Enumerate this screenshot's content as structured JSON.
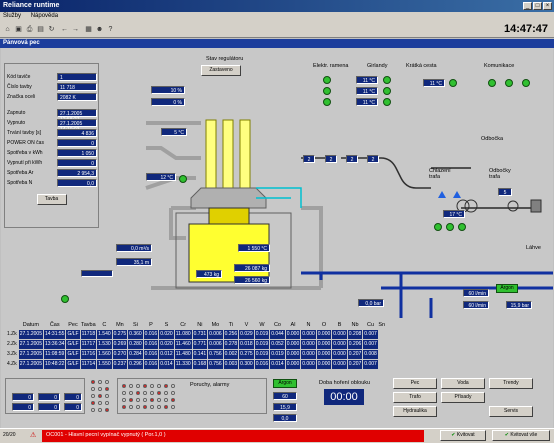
{
  "window": {
    "title": "Reliance runtime"
  },
  "menu": [
    "Služby",
    "Nápověda"
  ],
  "clock": "14:47:47",
  "panel_title": "Pánvová pec",
  "info": {
    "rows": [
      {
        "label": "Kód taviče",
        "value": "1"
      },
      {
        "label": "Číslo tavby",
        "value": "11 718"
      },
      {
        "label": "Značka oceli",
        "value": "2082 K"
      },
      {
        "label": "Zapnuto",
        "value": "27.1.2005 12:58:27"
      },
      {
        "label": "Vypnuto",
        "value": "27.1.2005 14:19:03"
      },
      {
        "label": "Trvání tavby [s]",
        "value": "4 836"
      },
      {
        "label": "POWER ON čas",
        "value": "0"
      },
      {
        "label": "Spotřeba v kWh",
        "value": "1 050"
      },
      {
        "label": "Vypnutí při kWh",
        "value": "0"
      },
      {
        "label": "Spotřeba Ar",
        "value": "2 954,3"
      },
      {
        "label": "Spotřeba N",
        "value": "0,0"
      }
    ],
    "button": "Tavba"
  },
  "regulator": {
    "label": "Stav regulátoru",
    "state": "Zastaveno"
  },
  "values": {
    "pct1": "10 %",
    "pct2": "0 %",
    "temp_top": "5 °C",
    "temp_left": "12 °C",
    "flow_ms": "0,0 m³/s",
    "flow_t": "35,1 m",
    "temp_ladle": "1 550 °C",
    "kg1": "473 kg",
    "kg2": "26 087 kg",
    "kg3": "26 560 kg",
    "bars": [
      "2",
      "2",
      "2",
      "2"
    ],
    "zone_temp": "17 °C",
    "odbocky_val": "5",
    "flow_bottom": "0,0 bar",
    "flow_lm1": "60 l/min",
    "flow_lm2": "60 l/min",
    "flow_bar2": "15,9 bar"
  },
  "elektr": {
    "label": "Elektr. ramena",
    "girlandy": "Girlandy",
    "kratka": "Krátká cesta",
    "komunikace": "Komunikace",
    "temps": [
      "11 °C",
      "11 °C",
      "11 °C"
    ],
    "kratka_temp": "11 °C"
  },
  "chlazeni": {
    "label": "Chlazení trafa",
    "odbocka": "Odbočka",
    "odbocky_trafa": "Odbočky trafa",
    "lahve": "Láhve",
    "argon": "Argon"
  },
  "table": {
    "headers": [
      "Datum",
      "Čas",
      "Pec",
      "Tavba",
      "C",
      "Mn",
      "Si",
      "P",
      "S",
      "Cr",
      "Ni",
      "Mo",
      "Ti",
      "V",
      "W",
      "Co",
      "Al",
      "N",
      "O",
      "B",
      "Nb",
      "Cu",
      "Sn"
    ],
    "rows": [
      [
        "1.Zk",
        "27.1.2005",
        "14:31:55",
        "G/LF",
        "11718",
        "1.540",
        "0.275",
        "0.360",
        "0.016",
        "0.020",
        "11.080",
        "0.731",
        "0.006",
        "0.256",
        "0.029",
        "0.019",
        "0.044",
        "0.000",
        "0.000",
        "0.000",
        "0.000",
        "0.208",
        "0.007"
      ],
      [
        "2.Zk",
        "27.1.2005",
        "13:36:34",
        "G/LF",
        "11717",
        "1.530",
        "0.269",
        "0.280",
        "0.016",
        "0.020",
        "11.460",
        "0.771",
        "0.006",
        "0.278",
        "0.018",
        "0.019",
        "0.052",
        "0.000",
        "0.000",
        "0.000",
        "0.000",
        "0.206",
        "0.007"
      ],
      [
        "3.Zk",
        "27.1.2005",
        "11:08:59",
        "G/LF",
        "11716",
        "1.560",
        "0.270",
        "0.284",
        "0.016",
        "0.012",
        "11.480",
        "0.141",
        "0.756",
        "0.002",
        "0.275",
        "0.019",
        "0.019",
        "0.000",
        "0.000",
        "0.000",
        "0.000",
        "0.207",
        "0.008"
      ],
      [
        "4.Zk",
        "27.1.2005",
        "10:48:22",
        "G/LF",
        "11714",
        "1.550",
        "0.237",
        "0.296",
        "0.016",
        "0.014",
        "11.330",
        "0.168",
        "0.756",
        "0.003",
        "0.300",
        "0.016",
        "0.014",
        "0.000",
        "0.000",
        "0.000",
        "0.000",
        "0.207",
        "0.007"
      ]
    ]
  },
  "bottom": {
    "poruchy": "Poruchy, alarmy",
    "argon": "Argon",
    "doba": "Doba hoření oblouku",
    "timer": "00:00",
    "argon_vals": [
      "60",
      "15,9",
      "0,0"
    ],
    "left_vals": [
      "0",
      "0",
      "0",
      "0",
      "0",
      "0"
    ],
    "nav": [
      "Pec",
      "Voda",
      "Trendy",
      "Trafo",
      "Přísady",
      "Hydraulika",
      "Servis"
    ]
  },
  "status": {
    "page": "20/20",
    "alarm": "OC001 - Hlavní pecní vypínač vypnutý ( Por.1,0 )",
    "kvitovat": "Kvitovat",
    "kvitovat_vse": "Kvitovat vše"
  }
}
